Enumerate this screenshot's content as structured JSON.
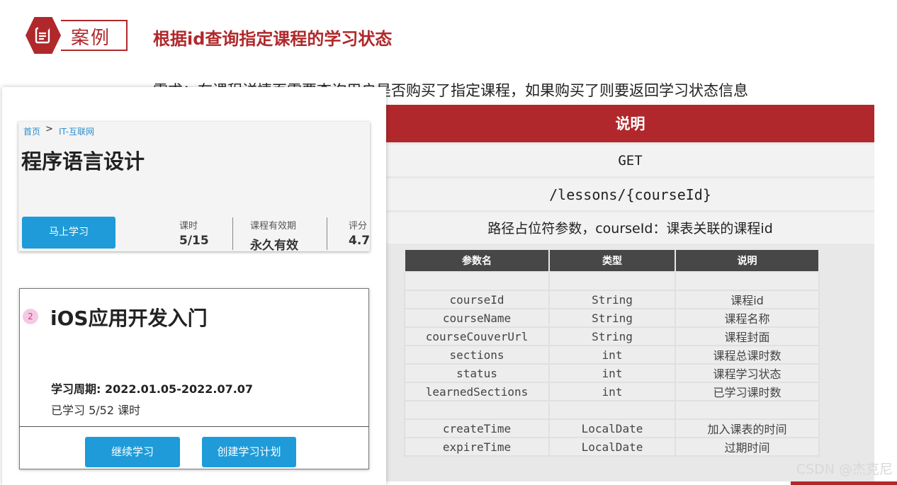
{
  "header": {
    "tag": "案例",
    "title": "根据id查询指定课程的学习状态"
  },
  "requirement": "需求：在课程详情页需要查询用户是否购买了指定课程，如果购买了则要返回学习状态信息",
  "course_card": {
    "breadcrumb": {
      "home": "首页",
      "separator": ">",
      "category": "IT-互联网"
    },
    "title": "程序语言设计",
    "start_button": "马上学习",
    "stats": [
      {
        "label": "课时",
        "value": "5/15"
      },
      {
        "label": "课程有效期",
        "value": "永久有效"
      },
      {
        "label": "评分",
        "value": "4.7"
      }
    ]
  },
  "plan_card": {
    "number": "2",
    "title": "iOS应用开发入门",
    "period": "学习周期: 2022.01.05-2022.07.07",
    "learned": "已学习   5/52 课时",
    "continue_button": "继续学习",
    "create_plan_button": "创建学习计划"
  },
  "spec": {
    "header": "说明",
    "method": "GET",
    "path": "/lessons/{courseId}",
    "path_param": "路径占位符参数，courseId：课表关联的课程id",
    "columns": [
      "参数名",
      "类型",
      "说明"
    ],
    "rows": [
      [
        "",
        "",
        ""
      ],
      [
        "courseId",
        "String",
        "课程id"
      ],
      [
        "courseName",
        "String",
        "课程名称"
      ],
      [
        "courseCouverUrl",
        "String",
        "课程封面"
      ],
      [
        "sections",
        "int",
        "课程总课时数"
      ],
      [
        "status",
        "int",
        "课程学习状态"
      ],
      [
        "learnedSections",
        "int",
        "已学习课时数"
      ],
      [
        "",
        "",
        ""
      ],
      [
        "createTime",
        "LocalDate",
        "加入课表的时间"
      ],
      [
        "expireTime",
        "LocalDate",
        "过期时间"
      ]
    ]
  },
  "watermark": "CSDN @杰克尼",
  "colors": {
    "accent": "#b0282b",
    "button_blue": "#1e9bd8",
    "table_header": "#474747"
  }
}
